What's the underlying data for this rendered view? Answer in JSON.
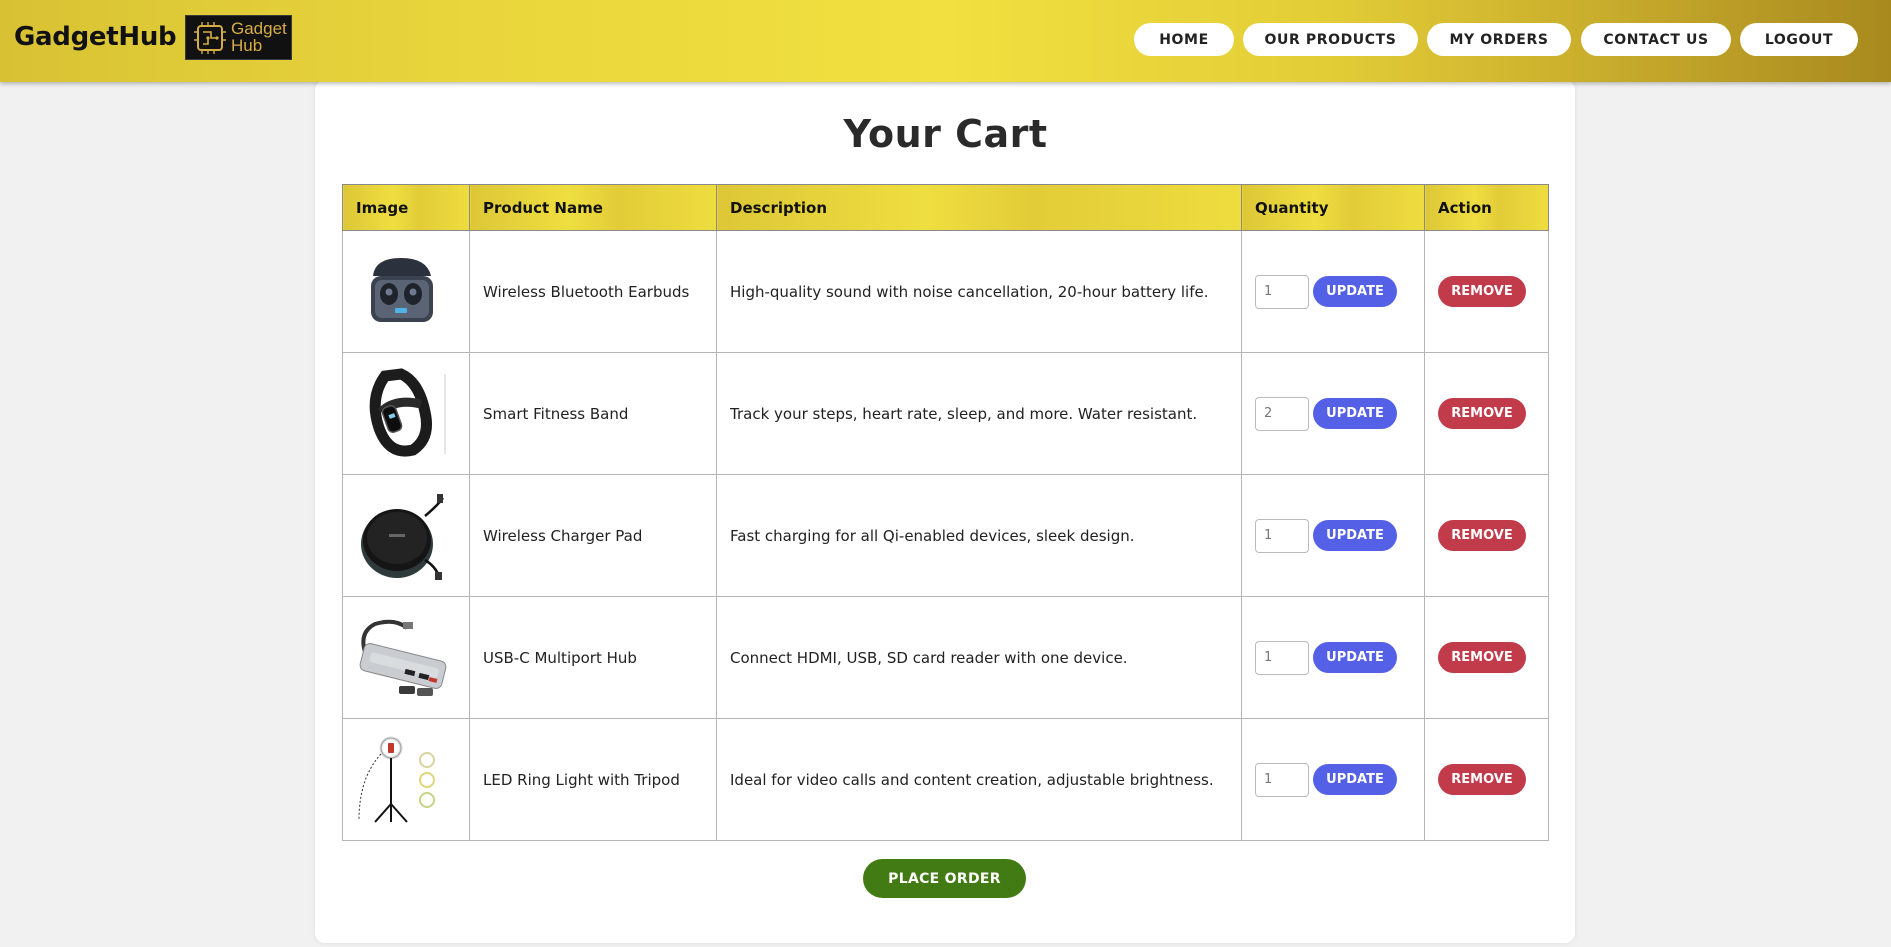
{
  "header": {
    "brand": "GadgetHub",
    "logo_line1": "Gadget",
    "logo_line2": "Hub",
    "nav": [
      {
        "label": "HOME"
      },
      {
        "label": "OUR PRODUCTS"
      },
      {
        "label": "MY ORDERS"
      },
      {
        "label": "CONTACT US"
      },
      {
        "label": "LOGOUT"
      }
    ]
  },
  "cart": {
    "title": "Your Cart",
    "columns": [
      "Image",
      "Product Name",
      "Description",
      "Quantity",
      "Action"
    ],
    "items": [
      {
        "name": "Wireless Bluetooth Earbuds",
        "description": "High-quality sound with noise cancellation, 20-hour battery life.",
        "quantity": "1",
        "image_icon": "earbuds-icon"
      },
      {
        "name": "Smart Fitness Band",
        "description": "Track your steps, heart rate, sleep, and more. Water resistant.",
        "quantity": "2",
        "image_icon": "fitness-band-icon"
      },
      {
        "name": "Wireless Charger Pad",
        "description": "Fast charging for all Qi-enabled devices, sleek design.",
        "quantity": "1",
        "image_icon": "charger-pad-icon"
      },
      {
        "name": "USB-C Multiport Hub",
        "description": "Connect HDMI, USB, SD card reader with one device.",
        "quantity": "1",
        "image_icon": "usb-hub-icon"
      },
      {
        "name": "LED Ring Light with Tripod",
        "description": "Ideal for video calls and content creation, adjustable brightness.",
        "quantity": "1",
        "image_icon": "ring-light-icon"
      }
    ],
    "update_label": "UPDATE",
    "remove_label": "REMOVE",
    "place_order_label": "PLACE ORDER"
  },
  "colors": {
    "header_gold": "#e9d63c",
    "update_blue": "#5460e6",
    "remove_red": "#c13b4b",
    "place_order_green": "#427a14"
  }
}
